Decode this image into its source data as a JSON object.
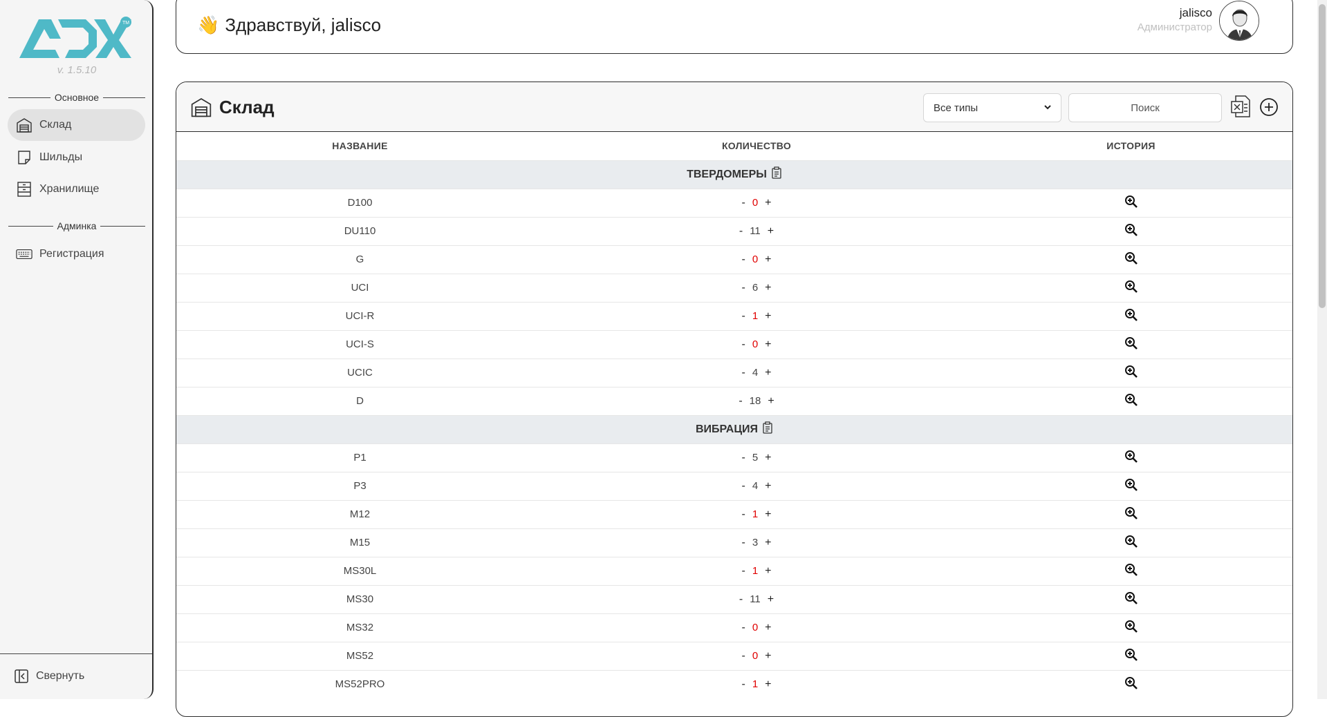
{
  "app": {
    "version": "v. 1.5.10"
  },
  "sidebar": {
    "sections": [
      {
        "label": "Основное"
      },
      {
        "label": "Админка"
      }
    ],
    "items": [
      {
        "label": "Склад",
        "icon": "warehouse-icon",
        "active": true
      },
      {
        "label": "Шильды",
        "icon": "note-icon",
        "active": false
      },
      {
        "label": "Хранилище",
        "icon": "cabinet-icon",
        "active": false
      },
      {
        "label": "Регистрация",
        "icon": "keyboard-icon",
        "active": false
      }
    ],
    "collapse_label": "Свернуть"
  },
  "header": {
    "greeting": "Здравствуй, jalisco",
    "greeting_emoji": "👋",
    "user_name": "jalisco",
    "user_role": "Администратор"
  },
  "warehouse": {
    "title": "Склад",
    "filter_selected": "Все типы",
    "search_placeholder": "Поиск",
    "columns": [
      "НАЗВАНИЕ",
      "КОЛИЧЕСТВО",
      "ИСТОРИЯ"
    ],
    "groups": [
      {
        "name": "ТВЕРДОМЕРЫ",
        "rows": [
          {
            "name": "D100",
            "qty": "0"
          },
          {
            "name": "DU110",
            "qty": "11"
          },
          {
            "name": "G",
            "qty": "0"
          },
          {
            "name": "UCI",
            "qty": "6"
          },
          {
            "name": "UCI-R",
            "qty": "1"
          },
          {
            "name": "UCI-S",
            "qty": "0"
          },
          {
            "name": "UCIC",
            "qty": "4"
          },
          {
            "name": "D",
            "qty": "18"
          }
        ]
      },
      {
        "name": "ВИБРАЦИЯ",
        "rows": [
          {
            "name": "P1",
            "qty": "5"
          },
          {
            "name": "P3",
            "qty": "4"
          },
          {
            "name": "M12",
            "qty": "1"
          },
          {
            "name": "M15",
            "qty": "3"
          },
          {
            "name": "MS30L",
            "qty": "1"
          },
          {
            "name": "MS30",
            "qty": "11"
          },
          {
            "name": "MS32",
            "qty": "0"
          },
          {
            "name": "MS52",
            "qty": "0"
          },
          {
            "name": "MS52PRO",
            "qty": "1"
          }
        ]
      }
    ],
    "qty_minus": "-",
    "qty_plus": "+"
  },
  "colors": {
    "accent": "#4fb9c7",
    "alert": "#e00000",
    "group_bg": "#e9ecef"
  }
}
